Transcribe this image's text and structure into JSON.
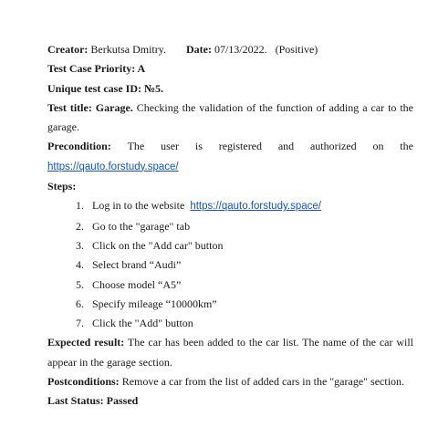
{
  "creator": {
    "label": "Creator:",
    "value": "Berkutsa Dmitry."
  },
  "date": {
    "label": "Date:",
    "value": "07/13/2022.",
    "type": "(Positive)"
  },
  "priority": "Test Case Priority: A",
  "unique_id": "Unique test case ID: №5.",
  "test_title": {
    "label": "Test title:",
    "bold": "Garage.",
    "text": "Checking the validation of the function of adding a car to the garage."
  },
  "precondition": {
    "label": "Precondition:",
    "words": [
      "The",
      "user",
      "is",
      "registered",
      "and",
      "authorized",
      "on",
      "the"
    ],
    "link": "https://qauto.forstudy.space/"
  },
  "steps": {
    "label": "Steps:",
    "items": [
      {
        "num": "1.",
        "text": "Log in to the website",
        "link": "https://qauto.forstudy.space/"
      },
      {
        "num": "2.",
        "text": "Go to the \"garage\" tab"
      },
      {
        "num": "3.",
        "text": "Click on the \"Add car\" button"
      },
      {
        "num": "4.",
        "text": "Select brand “Audi”"
      },
      {
        "num": "5.",
        "text": "Choose model “A5”"
      },
      {
        "num": "6.",
        "text": "Specify mileage “10000km”"
      },
      {
        "num": "7.",
        "text": "Click the \"Add\" button"
      }
    ]
  },
  "expected": {
    "label": "Expected result:",
    "text": "The car has been added to the car list. The name of the car will appear in the garage section."
  },
  "postconditions": {
    "label": "Postconditions:",
    "text": "Remove a car from the list of added cars in the \"garage\" section."
  },
  "last_status": "Last Status: Passed"
}
